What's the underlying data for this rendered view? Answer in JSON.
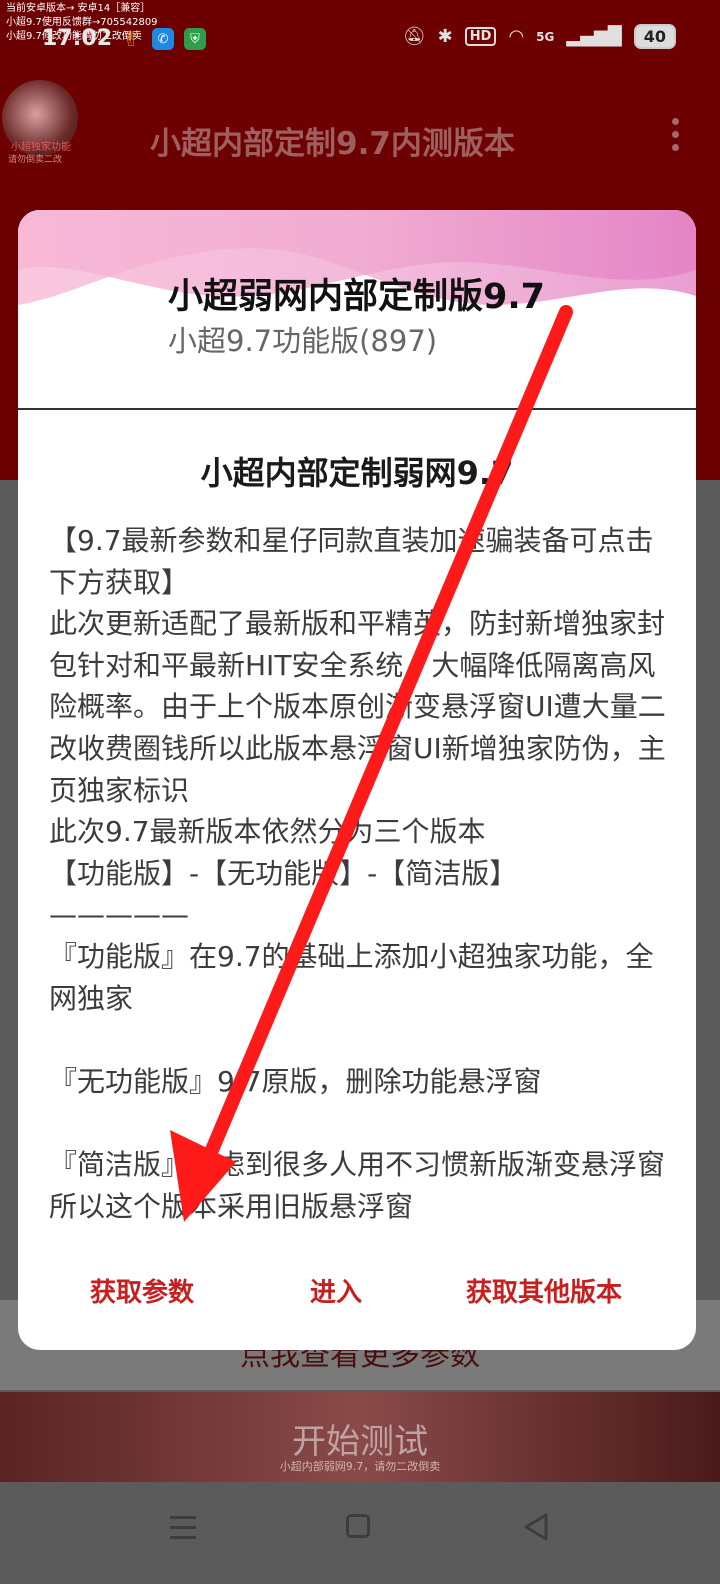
{
  "status_bar": {
    "overlay_lines": [
      "当前安卓版本→ 安卓14［兼容］",
      "小超9.7使用反馈群→705542809",
      "小超9.7修改功能请勿二改倒卖"
    ],
    "time": "17:02",
    "hd_badge": "HD",
    "network": "5G",
    "battery": "40"
  },
  "app_bar": {
    "avatar_label": "小超独家功能",
    "avatar_sub": "请勿倒卖二改",
    "title": "小超内部定制9.7内测版本"
  },
  "background": {
    "param_button": "点我查看更多参数",
    "start_button": "开始测试",
    "start_sub": "小超内部弱网9.7，请勿二改倒卖"
  },
  "dialog": {
    "title": "小超弱网内部定制版9.7",
    "subtitle": "小超9.7功能版(897)",
    "content_title": "小超内部定制弱网9.7",
    "content_body": "【9.7最新参数和星仔同款直装加速骗装备可点击下方获取】\n此次更新适配了最新版和平精英，防封新增独家封包针对和平最新HIT安全系统，大幅降低隔离高风险概率。由于上个版本原创渐变悬浮窗UI遭大量二改收费圈钱所以此版本悬浮窗UI新增独家防伪，主页独家标识\n此次9.7最新版本依然分为三个版本\n【功能版】-【无功能版】-【简洁版】\n—————\n『功能版』在9.7的基础上添加小超独家功能，全网独家\n\n『无功能版』9.7原版，删除功能悬浮窗\n\n『简洁版』考虑到很多人用不习惯新版渐变悬浮窗所以这个版本采用旧版悬浮窗",
    "buttons": {
      "get_params": "获取参数",
      "enter": "进入",
      "other_versions": "获取其他版本"
    }
  },
  "colors": {
    "accent_red": "#c81e1e",
    "brand_dark_red": "#6d0000",
    "annotation_arrow": "#ff1a1a"
  }
}
